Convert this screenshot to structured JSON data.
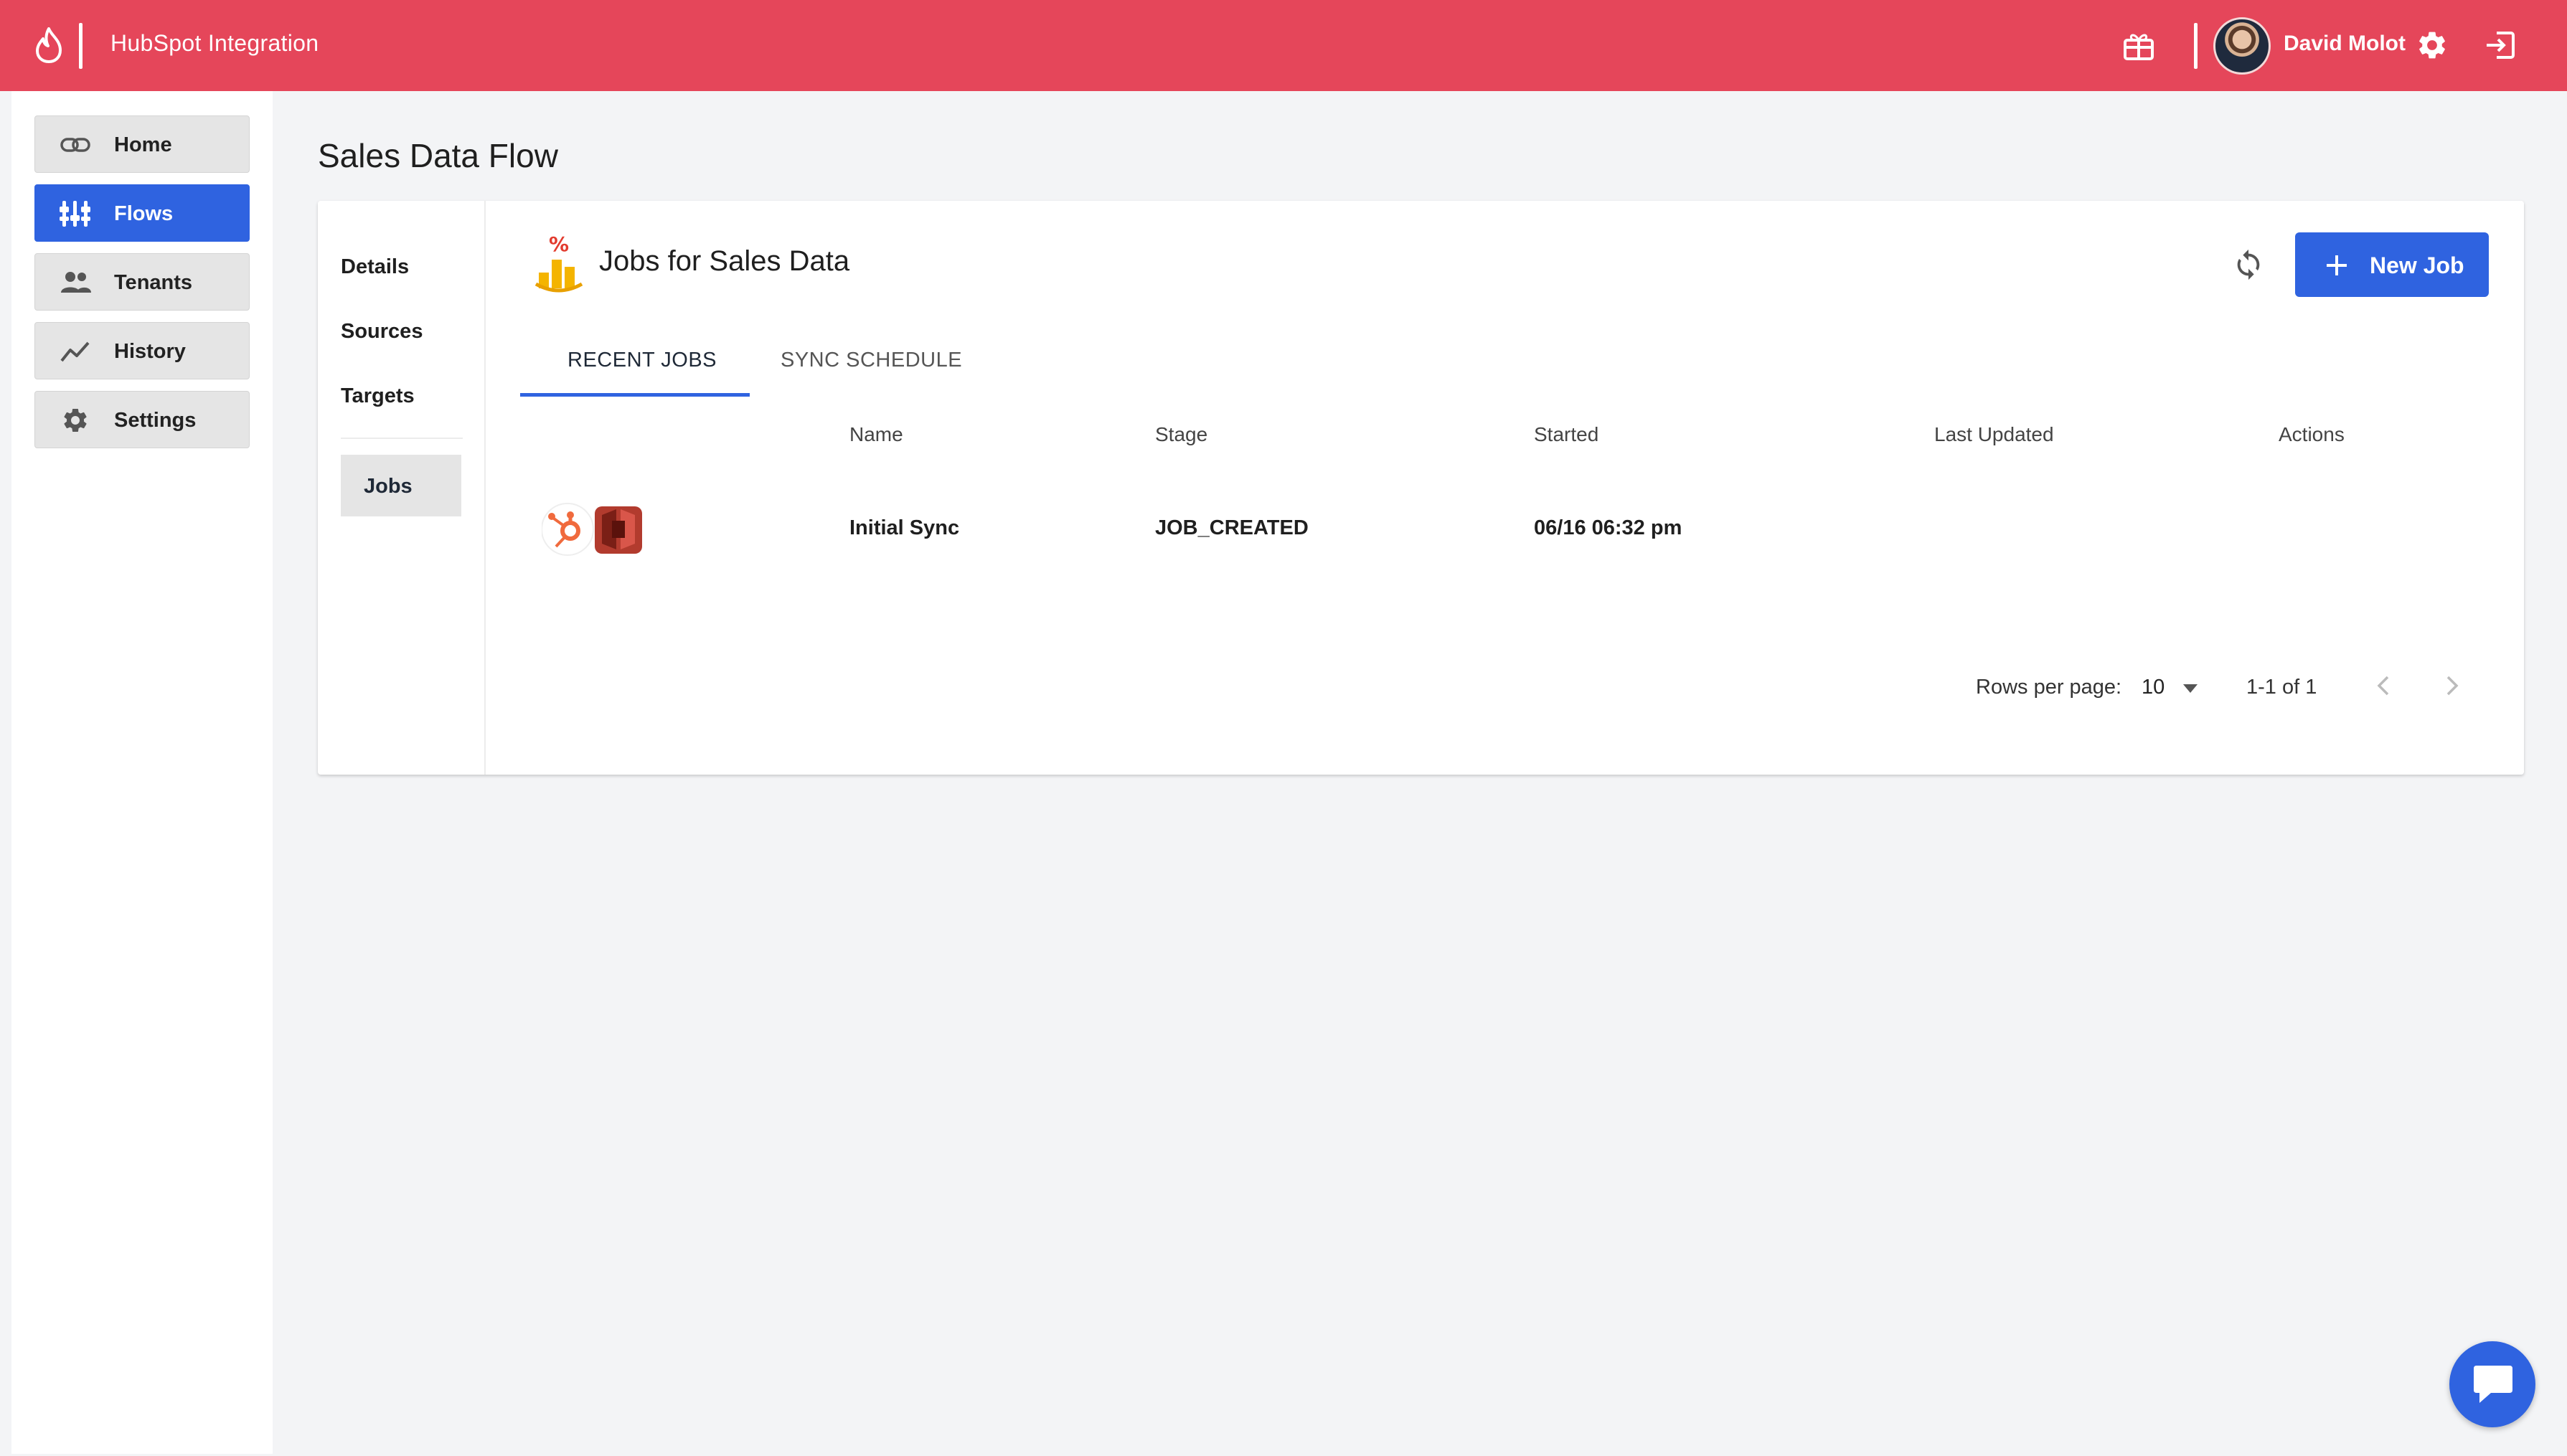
{
  "header": {
    "app_title": "HubSpot Integration",
    "user_name": "David Molot",
    "brand_color": "#e5465a",
    "icons": [
      "flame-logo-icon",
      "gift-icon",
      "avatar",
      "gear-icon",
      "logout-icon"
    ]
  },
  "sidebar": {
    "items": [
      {
        "label": "Home",
        "icon": "link-icon",
        "active": false
      },
      {
        "label": "Flows",
        "icon": "flows-icon",
        "active": true
      },
      {
        "label": "Tenants",
        "icon": "people-icon",
        "active": false
      },
      {
        "label": "History",
        "icon": "trend-icon",
        "active": false
      },
      {
        "label": "Settings",
        "icon": "gear-icon",
        "active": false
      }
    ],
    "active_color": "#2f63e0"
  },
  "main": {
    "page_title": "Sales Data Flow",
    "subnav": {
      "items": [
        "Details",
        "Sources",
        "Targets"
      ],
      "selected": "Jobs"
    },
    "jobs_title": "Jobs for Sales Data",
    "new_job_label": "New Job",
    "tabs": [
      {
        "label": "RECENT JOBS",
        "active": true
      },
      {
        "label": "SYNC SCHEDULE",
        "active": false
      }
    ],
    "table": {
      "columns": [
        "Name",
        "Stage",
        "Started",
        "Last Updated",
        "Actions"
      ],
      "rows": [
        {
          "name": "Initial Sync",
          "stage": "JOB_CREATED",
          "started": "06/16 06:32 pm",
          "last_updated": "",
          "actions": ""
        }
      ]
    },
    "pagination": {
      "rows_per_page_label": "Rows per page:",
      "rows_per_page": "10",
      "range": "1-1 of 1"
    }
  }
}
